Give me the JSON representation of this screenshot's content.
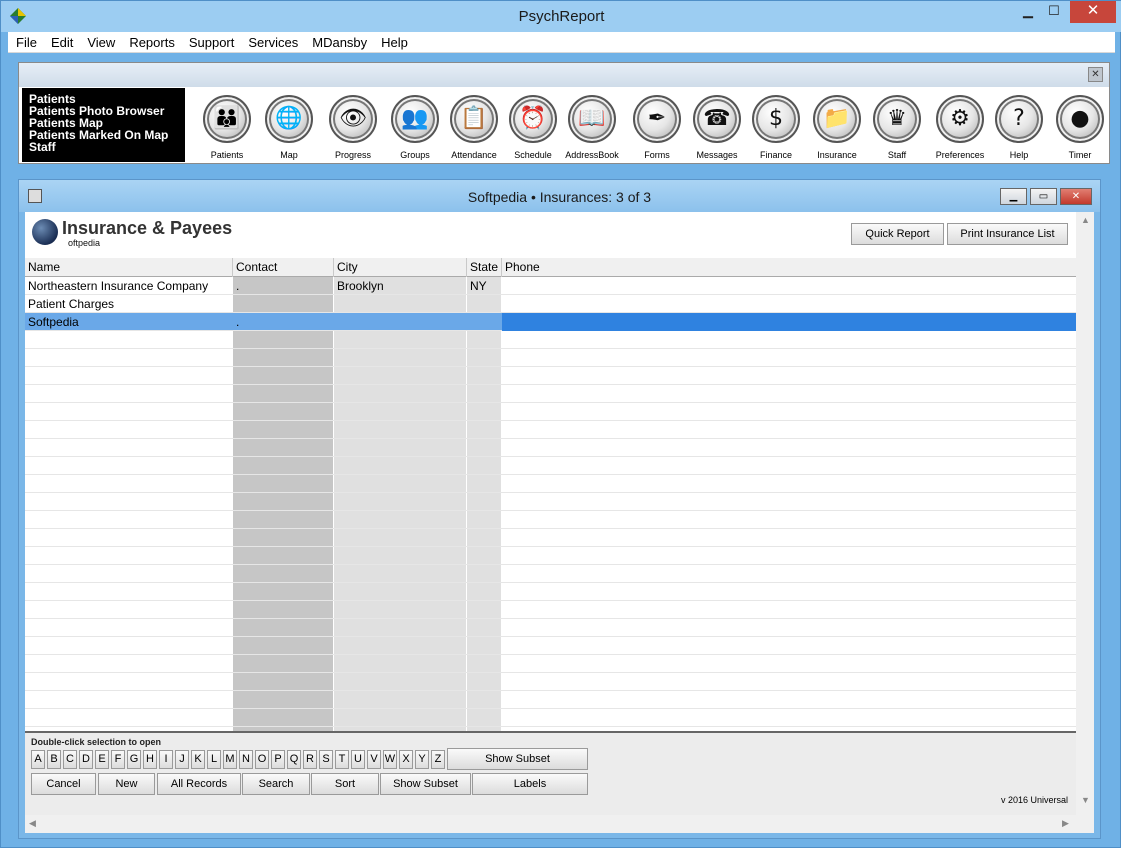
{
  "app": {
    "title": "PsychReport"
  },
  "menu": [
    "File",
    "Edit",
    "View",
    "Reports",
    "Support",
    "Services",
    "MDansby",
    "Help"
  ],
  "quicklinks": [
    "Patients",
    "Patients Photo Browser",
    "Patients Map",
    "Patients Marked On Map",
    "Staff"
  ],
  "tools": [
    {
      "label": "Patients",
      "icon": "patients-icon",
      "glyph": "👪"
    },
    {
      "label": "Map",
      "icon": "globe-icon",
      "glyph": "🌐"
    },
    {
      "label": "Progress",
      "icon": "eye-icon",
      "glyph": "👁"
    },
    {
      "label": "Groups",
      "icon": "group-icon",
      "glyph": "👥"
    },
    {
      "label": "Attendance",
      "icon": "clipboard-icon",
      "glyph": "📋"
    },
    {
      "label": "Schedule",
      "icon": "clock-icon",
      "glyph": "⏰"
    },
    {
      "label": "AddressBook",
      "icon": "book-icon",
      "glyph": "📖"
    },
    {
      "label": "Forms",
      "icon": "pen-icon",
      "glyph": "✒"
    },
    {
      "label": "Messages",
      "icon": "telephone-icon",
      "glyph": "☎"
    },
    {
      "label": "Finance",
      "icon": "dollar-icon",
      "glyph": "$"
    },
    {
      "label": "Insurance",
      "icon": "folder-icon",
      "glyph": "📁"
    },
    {
      "label": "Staff",
      "icon": "crown-icon",
      "glyph": "♛"
    },
    {
      "label": "Preferences",
      "icon": "gears-icon",
      "glyph": "⚙"
    },
    {
      "label": "Help",
      "icon": "question-icon",
      "glyph": "?"
    },
    {
      "label": "Timer",
      "icon": "record-icon",
      "glyph": "●"
    }
  ],
  "window": {
    "title": "Softpedia  •  Insurances: 3 of 3"
  },
  "section": {
    "title": "Insurance & Payees",
    "subtitle": "oftpedia"
  },
  "buttons": {
    "quick_report": "Quick Report",
    "print_list": "Print Insurance List"
  },
  "table": {
    "columns": [
      "Name",
      "Contact",
      "City",
      "State",
      "Phone"
    ],
    "rows": [
      {
        "name": "Northeastern Insurance Company",
        "contact": ".",
        "city": "Brooklyn",
        "state": "NY",
        "phone": ""
      },
      {
        "name": "Patient Charges",
        "contact": "",
        "city": "",
        "state": "",
        "phone": ""
      },
      {
        "name": "Softpedia",
        "contact": ".",
        "city": "",
        "state": "",
        "phone": "",
        "selected": true
      }
    ]
  },
  "bottom": {
    "hint": "Double-click selection to open",
    "letters": [
      "A",
      "B",
      "C",
      "D",
      "E",
      "F",
      "G",
      "H",
      "I",
      "J",
      "K",
      "L",
      "M",
      "N",
      "O",
      "P",
      "Q",
      "R",
      "S",
      "T",
      "U",
      "V",
      "W",
      "X",
      "Y",
      "Z"
    ],
    "show_subset_top": "Show Subset",
    "actions": [
      "Cancel",
      "New",
      "All Records",
      "Search",
      "Sort",
      "Show Subset",
      "Labels"
    ],
    "version": "v 2016 Universal"
  }
}
